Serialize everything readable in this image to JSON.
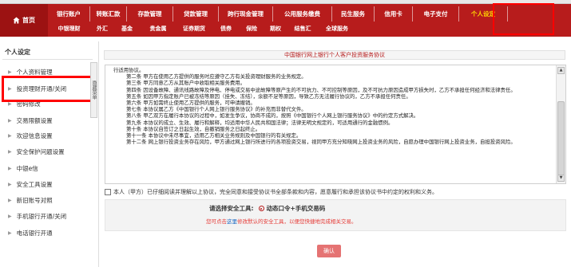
{
  "nav": {
    "home_label": "首页",
    "row1": [
      "银行账户",
      "转账汇款",
      "存款管理",
      "贷款管理",
      "跨行现金管理",
      "公用服务缴费",
      "民生服务",
      "信用卡",
      "电子支付",
      "个人设定"
    ],
    "row2": [
      "中银理财",
      "外汇",
      "基金",
      "贵金属",
      "证券期货",
      "债券",
      "保险",
      "期权",
      "结售汇",
      "全球服务"
    ],
    "active": "个人设定"
  },
  "sidebar": {
    "title": "个人设定",
    "items": [
      {
        "label": "个人资料管理"
      },
      {
        "label": "投资理财开通/关闭"
      },
      {
        "label": "密码修改"
      },
      {
        "label": "交易限额设置"
      },
      {
        "label": "欢迎信息设置"
      },
      {
        "label": "安全保护问题设置"
      },
      {
        "label": "中银e信"
      },
      {
        "label": "安全工具设置"
      },
      {
        "label": "新旧账号对照"
      },
      {
        "label": "手机银行开通/关闭"
      },
      {
        "label": "电话银行开通"
      }
    ],
    "collapse_label": "隐藏菜单"
  },
  "content": {
    "header": "中国银行网上银行个人客户投资服务协议",
    "agreement_lines": [
      {
        "text": "行适用协议。",
        "indent": false
      },
      {
        "text": "第二条 甲方在使用乙方提供的服务时应遵守乙方有关投资理财服务的业务规定。",
        "indent": true
      },
      {
        "text": "第三条 甲方同意乙方从其账户中收取相关服务费用。",
        "indent": true
      },
      {
        "text": "第四条 因设备故障、通讯线路故障及停电、停电或交易中途故障等原产生的不可抗力、不可控制等原因，及不可抗力原因造成甲方损失时，乙方不承担任何经济和法律责任。",
        "indent": true
      },
      {
        "text": "第五条 如因甲方指定账户已被冻结等原因（挂失、冻结），余额不足等原因，导致乙方无法履行协议的，乙方不承担任何责任。",
        "indent": true
      },
      {
        "text": "第六条 甲方如需终止使用乙方提供的服务，可申请撤销。",
        "indent": true
      },
      {
        "text": "第七条 本协议属乙方《中国银行个人网上银行服务协议》的补充而非替代文件。",
        "indent": true
      },
      {
        "text": "第八条 甲乙双方在履行本协议的过程中，如发生争议，协商不成的，按照《中国银行个人网上银行服务协议》中的约定方式解决。",
        "indent": true
      },
      {
        "text": "第九条 本协议的成立、生效、履行和解释，均适用中华人民共和国法律；法律无明文规定的，可适用通行的金融惯例。",
        "indent": true
      },
      {
        "text": "第十条 本协议自签订之日起生效，自撤销服务之日起终止。",
        "indent": true
      },
      {
        "text": "第十一条 本协议中未尽事宜，适用乙方相关业务规则及中国银行的有关规定。",
        "indent": true
      },
      {
        "text": "第十二条 网上银行投资业务存在风险，甲方通过网上银行所进行的各项投资交易，视同甲方充分知晓网上投资业务的风险，自愿办理中国银行网上投资业务，自担投资风险。",
        "indent": true
      }
    ],
    "agree_text": "本人（甲方）已仔细阅读并理解以上协议，完全同意和接受协议书全部条款和内容，愿意履行和承担该协议书中约定的权利和义务。",
    "security_title": "请选择安全工具:",
    "security_option": "动态口令+手机交易码",
    "security_note_pre": "您可点击",
    "security_note_link": "这里",
    "security_note_post": "修改默认的安全工具，以便您快捷地完成相关交易。",
    "confirm_label": "确认"
  }
}
